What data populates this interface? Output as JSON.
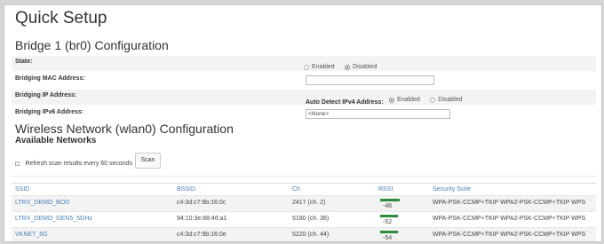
{
  "page": {
    "title": "Quick Setup"
  },
  "bridge": {
    "heading": "Bridge 1 (br0) Configuration",
    "state": {
      "label": "State:",
      "options": [
        "Enabled",
        "Disabled"
      ],
      "selected": "Disabled"
    },
    "mac": {
      "label": "Bridging MAC Address:",
      "value": ""
    },
    "ip": {
      "label": "Bridging IP Address:",
      "auto_label": "Auto Detect IPv4 Address:",
      "options": [
        "Enabled",
        "Disabled"
      ],
      "selected": "Enabled"
    },
    "ipv6": {
      "label": "Bridging IPv6 Address:",
      "value": "<None>"
    }
  },
  "wireless": {
    "heading": "Wireless Network (wlan0) Configuration",
    "subheading": "Available Networks",
    "refresh_label": "Refresh scan results every 60 seconds",
    "refresh_checked": false,
    "scan_label": "Scan",
    "columns": [
      "SSID",
      "BSSID",
      "Ch",
      "RSSI",
      "Security Suite"
    ],
    "networks": [
      {
        "ssid": "LTRX_DEMO_BOD",
        "bssid": "c4:3d:c7:9b:16:0c",
        "ch": "2417 (ch. 2)",
        "rssi": "-46",
        "rssi_level": 1.0,
        "security": "WPA-PSK-CCMP+TKIP WPA2-PSK-CCMP+TKIP WPS"
      },
      {
        "ssid": "LTRX_DEMO_GEN5_5GHz",
        "bssid": "94:10:3e:88:46:a1",
        "ch": "5180 (ch. 36)",
        "rssi": "-52",
        "rssi_level": 0.9,
        "security": "WPA-PSK-CCMP+TKIP WPA2-PSK-CCMP+TKIP WPS"
      },
      {
        "ssid": "VKNET_5G",
        "bssid": "c4:3d:c7:9b:16:0e",
        "ch": "5220 (ch. 44)",
        "rssi": "-54",
        "rssi_level": 0.9,
        "security": "WPA-PSK-CCMP+TKIP WPA2-PSK-CCMP+TKIP WPS"
      }
    ]
  },
  "colors": {
    "link": "#4a7fb5",
    "rssi_bar": "#2e8b3a"
  }
}
